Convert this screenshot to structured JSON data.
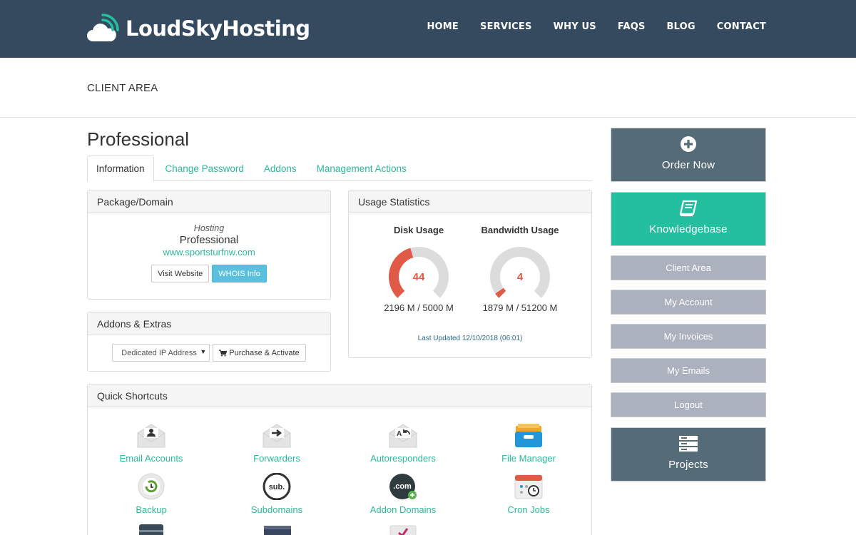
{
  "header": {
    "logo_text": "LoudSkyHosting",
    "nav": [
      "HOME",
      "SERVICES",
      "WHY US",
      "FAQS",
      "BLOG",
      "CONTACT"
    ]
  },
  "breadcrumb": "CLIENT AREA",
  "page_title": "Professional",
  "tabs": [
    "Information",
    "Change Password",
    "Addons",
    "Management Actions"
  ],
  "package_panel": {
    "title": "Package/Domain",
    "type": "Hosting",
    "name": "Professional",
    "domain": "www.sportsturfnw.com",
    "visit_label": "Visit Website",
    "whois_label": "WHOIS Info"
  },
  "addons_panel": {
    "title": "Addons & Extras",
    "select_value": "Dedicated IP Address",
    "purchase_label": "Purchase & Activate"
  },
  "usage_panel": {
    "title": "Usage Statistics",
    "disk": {
      "title": "Disk Usage",
      "percent": 44,
      "amount": "2196 M / 5000 M"
    },
    "bandwidth": {
      "title": "Bandwidth Usage",
      "percent": 4,
      "amount": "1879 M / 51200 M"
    },
    "last_updated": "Last Updated 12/10/2018 (06:01)"
  },
  "shortcuts_panel": {
    "title": "Quick Shortcuts",
    "items": [
      {
        "label": "Email Accounts",
        "icon": "email-accounts-icon"
      },
      {
        "label": "Forwarders",
        "icon": "forwarders-icon"
      },
      {
        "label": "Autoresponders",
        "icon": "autoresponders-icon"
      },
      {
        "label": "File Manager",
        "icon": "file-manager-icon"
      },
      {
        "label": "Backup",
        "icon": "backup-icon"
      },
      {
        "label": "Subdomains",
        "icon": "subdomains-icon"
      },
      {
        "label": "Addon Domains",
        "icon": "addon-domains-icon"
      },
      {
        "label": "Cron Jobs",
        "icon": "cron-jobs-icon"
      }
    ],
    "icon_text": {
      "subdomains": "sub.",
      "addon": ".com"
    }
  },
  "sidebar": {
    "order_now": "Order Now",
    "knowledgebase": "Knowledgebase",
    "links": [
      "Client Area",
      "My Account",
      "My Invoices",
      "My Emails",
      "Logout"
    ],
    "projects": "Projects"
  },
  "colors": {
    "header_bg": "#354a5f",
    "accent_teal": "#2cb89b",
    "gauge_red": "#e05a46",
    "sidebar_dark": "#566b78",
    "sidebar_grey": "#acb1be"
  }
}
